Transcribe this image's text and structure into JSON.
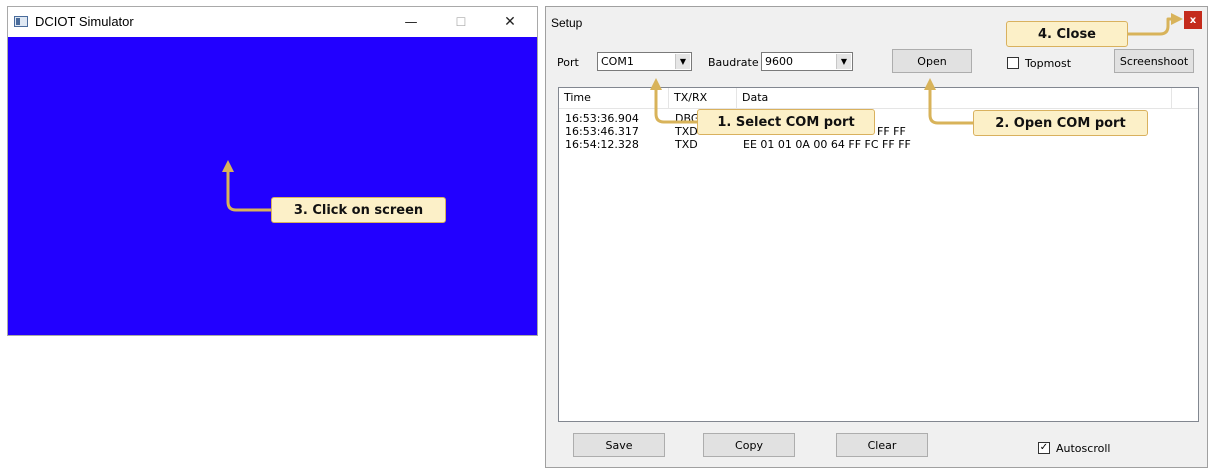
{
  "simulator": {
    "title": "DCIOT Simulator",
    "minimize_glyph": "—",
    "maximize_glyph": "☐",
    "close_glyph": "✕",
    "screen_color": "#2200ff"
  },
  "setup": {
    "title": "Setup",
    "close_glyph": "x",
    "port_label": "Port",
    "port_value": "COM1",
    "baudrate_label": "Baudrate",
    "baudrate_value": "9600",
    "open_label": "Open",
    "topmost_label": "Topmost",
    "topmost_checked": false,
    "screenshoot_label": "Screenshoot",
    "save_label": "Save",
    "copy_label": "Copy",
    "clear_label": "Clear",
    "autoscroll_label": "Autoscroll",
    "autoscroll_checked": true,
    "log": {
      "columns": [
        "Time",
        "TX/RX",
        "Data"
      ],
      "rows": [
        {
          "time": "16:53:36.904",
          "dir": "DBG",
          "data": ""
        },
        {
          "time": "16:53:46.317",
          "dir": "TXD",
          "data": "FF FF"
        },
        {
          "time": "16:54:12.328",
          "dir": "TXD",
          "data": "EE 01 01 0A 00 64 FF FC FF FF"
        }
      ]
    }
  },
  "callouts": {
    "step1": "1. Select COM port",
    "step2": "2. Open COM port",
    "step3": "3. Click on screen",
    "step4": "4. Close"
  },
  "colors": {
    "accent_arrow": "#d8b35a",
    "callout_bg": "#fcf0c8",
    "close_red": "#c42b1c"
  }
}
